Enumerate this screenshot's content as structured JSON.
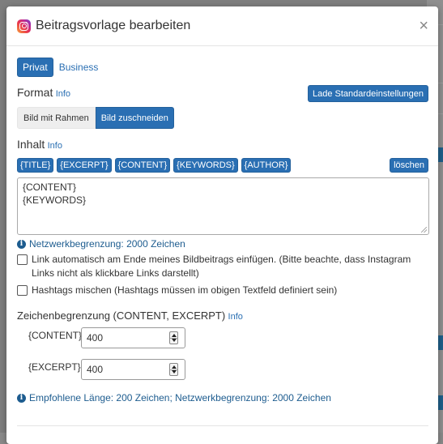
{
  "dialog": {
    "title": "Beitragsvorlage bearbeiten",
    "close_label": "×"
  },
  "tabs": [
    {
      "label": "Privat",
      "active": true
    },
    {
      "label": "Business",
      "active": false
    }
  ],
  "format": {
    "title": "Format",
    "info_link": "Info",
    "reset_button": "Lade Standardeinstellungen",
    "options": [
      {
        "label": "Bild mit Rahmen",
        "selected": false
      },
      {
        "label": "Bild zuschneiden",
        "selected": true
      }
    ]
  },
  "content": {
    "title": "Inhalt",
    "info_link": "Info",
    "tokens": [
      "{TITLE}",
      "{EXCERPT}",
      "{CONTENT}",
      "{KEYWORDS}",
      "{AUTHOR}"
    ],
    "clear_button": "löschen",
    "textarea_lines": [
      "{CONTENT}",
      "{KEYWORDS}"
    ],
    "network_limit": "Netzwerkbegrenzung: 2000 Zeichen",
    "checkbox_link": "Link automatisch am Ende meines Bildbeitrags einfügen. (Bitte beachte, dass Instagram Links nicht als klickbare Links darstellt)",
    "checkbox_hashtags": "Hashtags mischen (Hashtags müssen im obigen Textfeld definiert sein)"
  },
  "limits": {
    "title": "Zeichenbegrenzung (CONTENT, EXCERPT)",
    "info_link": "Info",
    "content_label": "{CONTENT}",
    "content_value": "400",
    "excerpt_label": "{EXCERPT}",
    "excerpt_value": "400",
    "recommendation": "Empfohlene Länge: 200 Zeichen; Netzwerkbegrenzung: 2000 Zeichen"
  },
  "colors": {
    "primary": "#2a6fb3",
    "info_text": "#1d5c8f"
  }
}
